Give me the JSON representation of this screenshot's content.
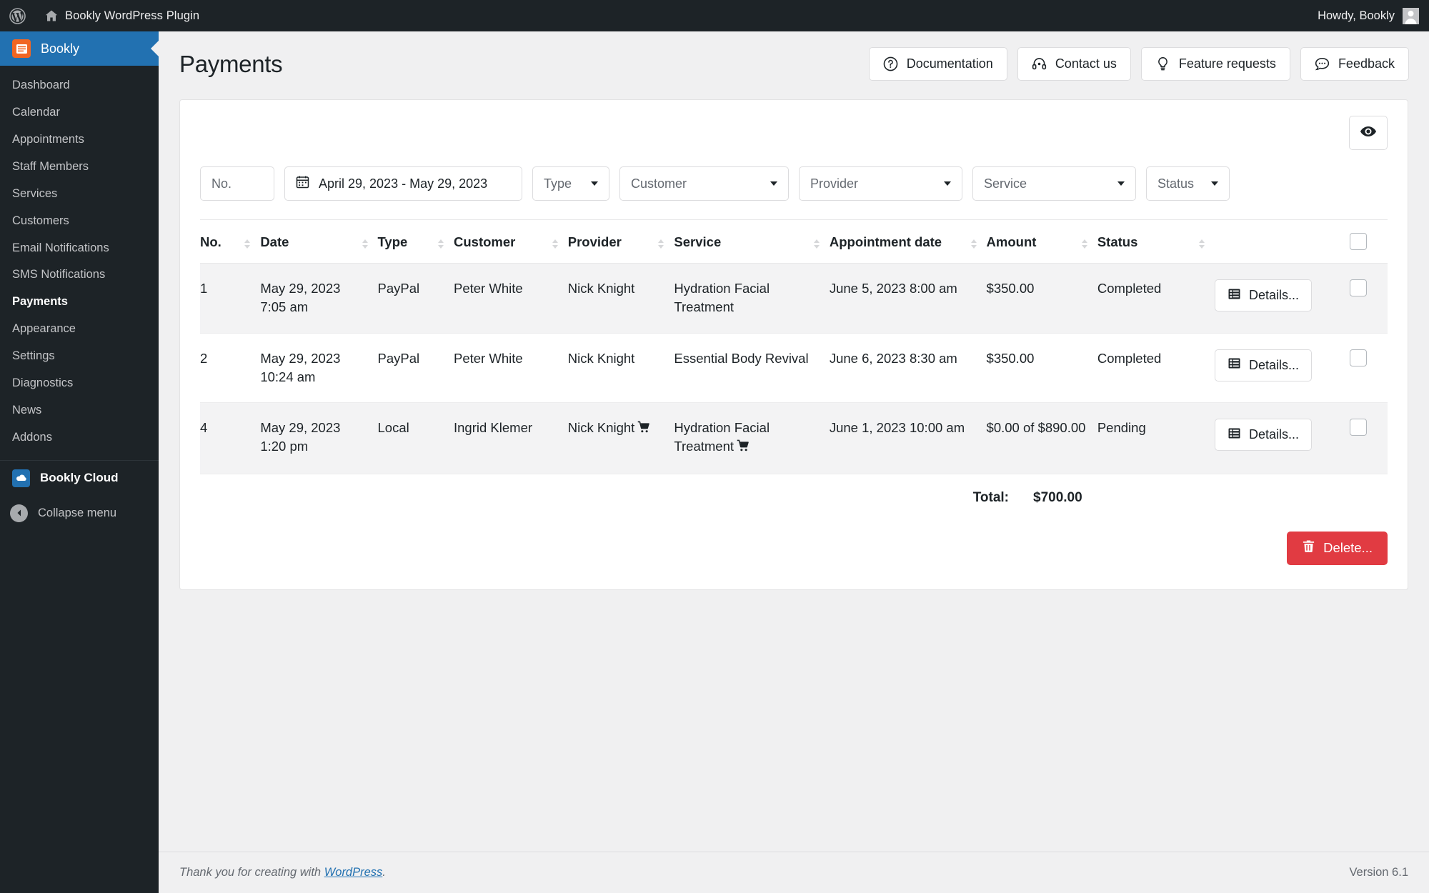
{
  "adminbar": {
    "wp_logo_icon": "wordpress-logo-icon",
    "home_icon": "home-icon",
    "site_title": "Bookly WordPress Plugin",
    "howdy": "Howdy, Bookly",
    "avatar_icon": "avatar-icon"
  },
  "sidebar": {
    "current_menu": "Bookly",
    "menu_icon": "bookly-icon",
    "items": [
      {
        "label": "Dashboard",
        "current": false
      },
      {
        "label": "Calendar",
        "current": false
      },
      {
        "label": "Appointments",
        "current": false
      },
      {
        "label": "Staff Members",
        "current": false
      },
      {
        "label": "Services",
        "current": false
      },
      {
        "label": "Customers",
        "current": false
      },
      {
        "label": "Email Notifications",
        "current": false
      },
      {
        "label": "SMS Notifications",
        "current": false
      },
      {
        "label": "Payments",
        "current": true
      },
      {
        "label": "Appearance",
        "current": false
      },
      {
        "label": "Settings",
        "current": false
      },
      {
        "label": "Diagnostics",
        "current": false
      },
      {
        "label": "News",
        "current": false
      },
      {
        "label": "Addons",
        "current": false
      }
    ],
    "cloud": {
      "label": "Bookly Cloud",
      "icon": "cloud-icon"
    },
    "collapse": {
      "label": "Collapse menu",
      "icon": "chevron-left-icon"
    }
  },
  "header": {
    "title": "Payments",
    "buttons": [
      {
        "label": "Documentation",
        "icon": "question-circle-icon"
      },
      {
        "label": "Contact us",
        "icon": "headset-icon"
      },
      {
        "label": "Feature requests",
        "icon": "lightbulb-icon"
      },
      {
        "label": "Feedback",
        "icon": "comment-dots-icon"
      }
    ]
  },
  "toolbar": {
    "eye_icon": "eye-icon"
  },
  "filters": {
    "no_placeholder": "No.",
    "date_range": "April 29, 2023 - May 29, 2023",
    "date_icon": "calendar-icon",
    "type": "Type",
    "customer": "Customer",
    "provider": "Provider",
    "service": "Service",
    "status": "Status"
  },
  "table": {
    "columns": [
      {
        "label": "No.",
        "sortable": true
      },
      {
        "label": "Date",
        "sortable": true
      },
      {
        "label": "Type",
        "sortable": true
      },
      {
        "label": "Customer",
        "sortable": true
      },
      {
        "label": "Provider",
        "sortable": true
      },
      {
        "label": "Service",
        "sortable": true
      },
      {
        "label": "Appointment date",
        "sortable": true
      },
      {
        "label": "Amount",
        "sortable": true
      },
      {
        "label": "Status",
        "sortable": true
      }
    ],
    "select_all_checkbox": "select-all-checkbox",
    "rows": [
      {
        "no": "1",
        "date": "May 29, 2023 7:05 am",
        "type": "PayPal",
        "customer": "Peter White",
        "provider": "Nick Knight",
        "provider_cart": false,
        "service": "Hydration Facial Treatment",
        "service_cart": false,
        "appointment_date": "June 5, 2023 8:00 am",
        "amount": "$350.00",
        "status": "Completed",
        "details_label": "Details...",
        "details_icon": "list-table-icon"
      },
      {
        "no": "2",
        "date": "May 29, 2023 10:24 am",
        "type": "PayPal",
        "customer": "Peter White",
        "provider": "Nick Knight",
        "provider_cart": false,
        "service": "Essential Body Revival",
        "service_cart": false,
        "appointment_date": "June 6, 2023 8:30 am",
        "amount": "$350.00",
        "status": "Completed",
        "details_label": "Details...",
        "details_icon": "list-table-icon"
      },
      {
        "no": "4",
        "date": "May 29, 2023 1:20 pm",
        "type": "Local",
        "customer": "Ingrid Klemer",
        "provider": "Nick Knight",
        "provider_cart": true,
        "service": "Hydration Facial Treatment",
        "service_cart": true,
        "appointment_date": "June 1, 2023 10:00 am",
        "amount": "$0.00 of $890.00",
        "status": "Pending",
        "details_label": "Details...",
        "details_icon": "list-table-icon"
      }
    ],
    "total_label": "Total:",
    "total_value": "$700.00"
  },
  "actions": {
    "delete_label": "Delete...",
    "delete_icon": "trash-icon",
    "delete_color": "#e13b42"
  },
  "footer": {
    "thanks_prefix": "Thank you for creating with ",
    "thanks_link": "WordPress",
    "thanks_suffix": ".",
    "version": "Version 6.1"
  }
}
